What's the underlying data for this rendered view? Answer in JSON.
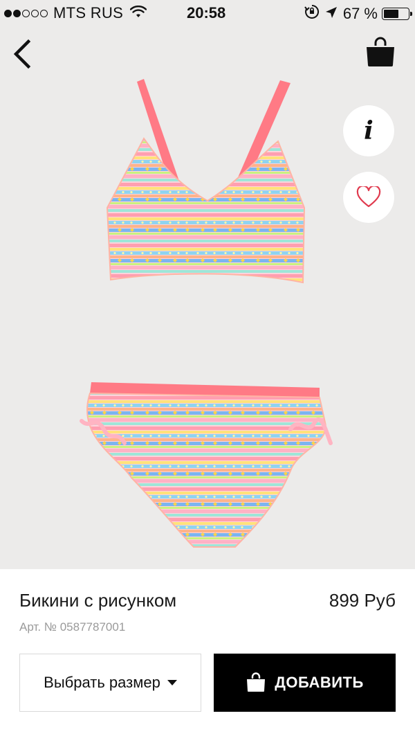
{
  "status_bar": {
    "carrier": "MTS RUS",
    "time": "20:58",
    "battery": "67 %",
    "battery_level": 0.67,
    "signal_bars_filled": 2,
    "signal_bars_total": 5
  },
  "nav": {
    "back_icon": "chevron-left-icon",
    "cart_icon": "shopping-bag-icon"
  },
  "actions": {
    "info_label": "i",
    "favorite_icon": "heart-outline-icon"
  },
  "product": {
    "title": "Бикини с рисунком",
    "price": "899 Руб",
    "article": "Арт. № 0587787001"
  },
  "buttons": {
    "size_label": "Выбрать размер",
    "add_label": "ДОБАВИТЬ"
  },
  "colors": {
    "photo_background": "#ecebea",
    "primary_button": "#000000",
    "accent_pink": "#ff7a85"
  }
}
